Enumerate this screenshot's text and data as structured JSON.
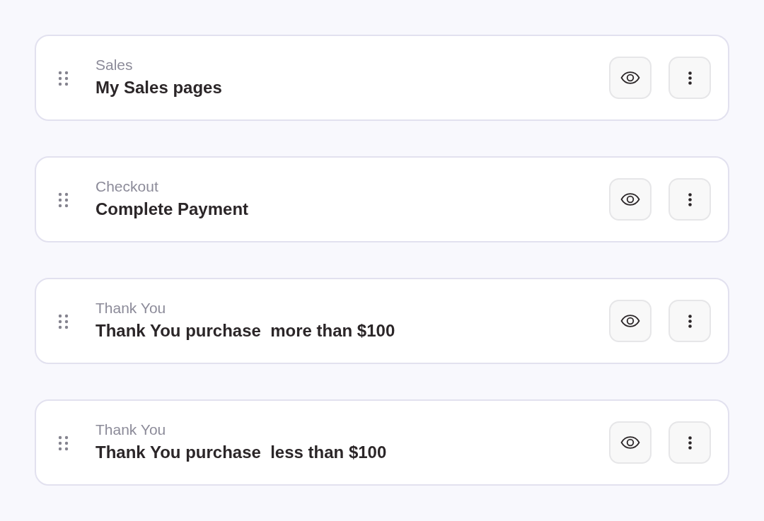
{
  "pages": [
    {
      "type": "Sales",
      "title": "My Sales pages"
    },
    {
      "type": "Checkout",
      "title": "Complete Payment"
    },
    {
      "type": "Thank You",
      "title": "Thank You purchase  more than $100"
    },
    {
      "type": "Thank You",
      "title": "Thank You purchase  less than $100"
    }
  ]
}
